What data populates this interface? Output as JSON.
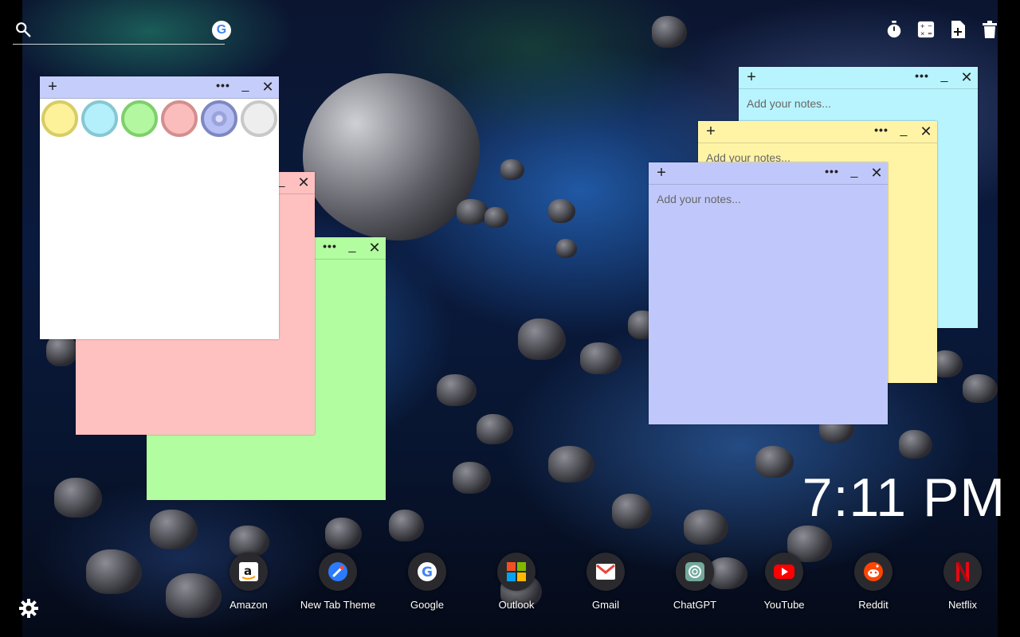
{
  "search": {
    "placeholder": "",
    "engine_letter": "G",
    "icon": "search-icon"
  },
  "toolbar": {
    "icons": [
      "timer-icon",
      "calculator-icon",
      "new-note-icon",
      "trash-icon"
    ]
  },
  "notes": {
    "palette_note": {
      "color": "#ffffff",
      "header_color": "#c5cdfa",
      "add": "+",
      "more": "•••",
      "minimize": "_",
      "close": "✕",
      "swatches": [
        {
          "name": "yellow",
          "fill": "#fdf19a",
          "border": "#d8cc66"
        },
        {
          "name": "cyan",
          "fill": "#b3f0fb",
          "border": "#86c7d3"
        },
        {
          "name": "green",
          "fill": "#b3f7a0",
          "border": "#7fcf6b"
        },
        {
          "name": "pink",
          "fill": "#fbbcbc",
          "border": "#d38f8f"
        },
        {
          "name": "periwinkle",
          "fill": "#b7c0f5",
          "border": "#7f88c0"
        },
        {
          "name": "white",
          "fill": "#eeeeee",
          "border": "#c8c8c8"
        }
      ]
    },
    "pink": {
      "color": "#ffc0c0",
      "more": "•••",
      "minimize": "_",
      "close": "✕"
    },
    "green": {
      "color": "#b2fda0",
      "more": "•••",
      "minimize": "_",
      "close": "✕"
    },
    "cyan": {
      "color": "#b8f4fd",
      "add": "+",
      "more": "•••",
      "minimize": "_",
      "close": "✕",
      "placeholder": "Add your notes..."
    },
    "yellow": {
      "color": "#fff4a6",
      "add": "+",
      "more": "•••",
      "minimize": "_",
      "close": "✕",
      "placeholder": "Add your notes..."
    },
    "blue": {
      "color": "#c0c8fb",
      "add": "+",
      "more": "•••",
      "minimize": "_",
      "close": "✕",
      "placeholder": "Add your notes..."
    }
  },
  "clock": {
    "time": "7:11 PM"
  },
  "dock": [
    {
      "label": "Amazon",
      "icon": "amazon-icon"
    },
    {
      "label": "New Tab Theme",
      "icon": "new-tab-theme-icon"
    },
    {
      "label": "Google",
      "icon": "google-icon"
    },
    {
      "label": "Outlook",
      "icon": "outlook-icon"
    },
    {
      "label": "Gmail",
      "icon": "gmail-icon"
    },
    {
      "label": "ChatGPT",
      "icon": "chatgpt-icon"
    },
    {
      "label": "YouTube",
      "icon": "youtube-icon"
    },
    {
      "label": "Reddit",
      "icon": "reddit-icon"
    },
    {
      "label": "Netflix",
      "icon": "netflix-icon"
    }
  ],
  "settings": {
    "icon": "gear-icon"
  }
}
